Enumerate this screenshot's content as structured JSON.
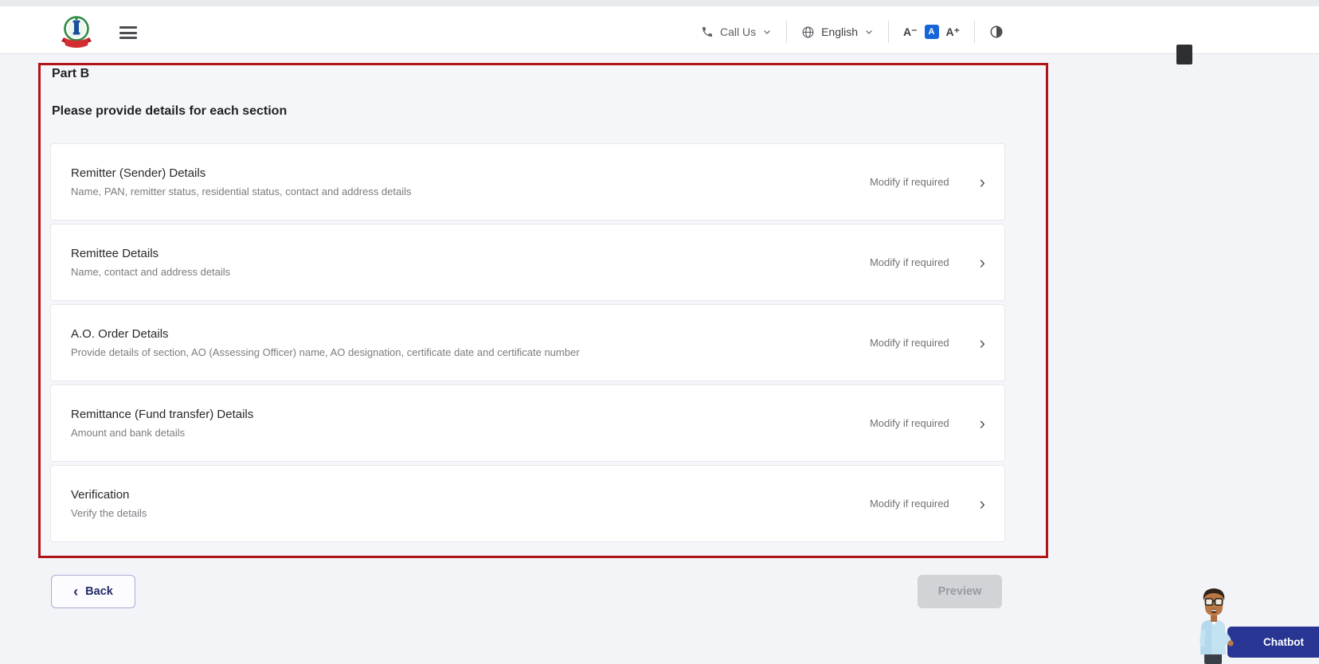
{
  "header": {
    "call_us_label": "Call Us",
    "language_selected": "English",
    "font_size": {
      "decrease": "A⁻",
      "default": "A",
      "increase": "A⁺"
    }
  },
  "content": {
    "part_title": "Part B",
    "heading": "Please provide details for each section",
    "sections": [
      {
        "title": "Remitter (Sender) Details",
        "subtitle": "Name, PAN, remitter status, residential status, contact and address details",
        "action": "Modify if required"
      },
      {
        "title": "Remittee Details",
        "subtitle": "Name, contact and address details",
        "action": "Modify if required"
      },
      {
        "title": "A.O. Order Details",
        "subtitle": "Provide details of section, AO (Assessing Officer) name, AO designation, certificate date and certificate number",
        "action": "Modify if required"
      },
      {
        "title": "Remittance (Fund transfer) Details",
        "subtitle": "Amount and bank details",
        "action": "Modify if required"
      },
      {
        "title": "Verification",
        "subtitle": "Verify the details",
        "action": "Modify if required"
      }
    ],
    "back_label": "Back",
    "preview_label": "Preview"
  },
  "chatbot": {
    "label": "Chatbot"
  },
  "icons": {
    "chevron_right": "›",
    "chevron_left": "‹"
  },
  "colors": {
    "panel_border": "#b01418",
    "chatbot_bg": "#283593",
    "font_active_bg": "#1565d8",
    "page_bg": "#f3f4f8"
  }
}
